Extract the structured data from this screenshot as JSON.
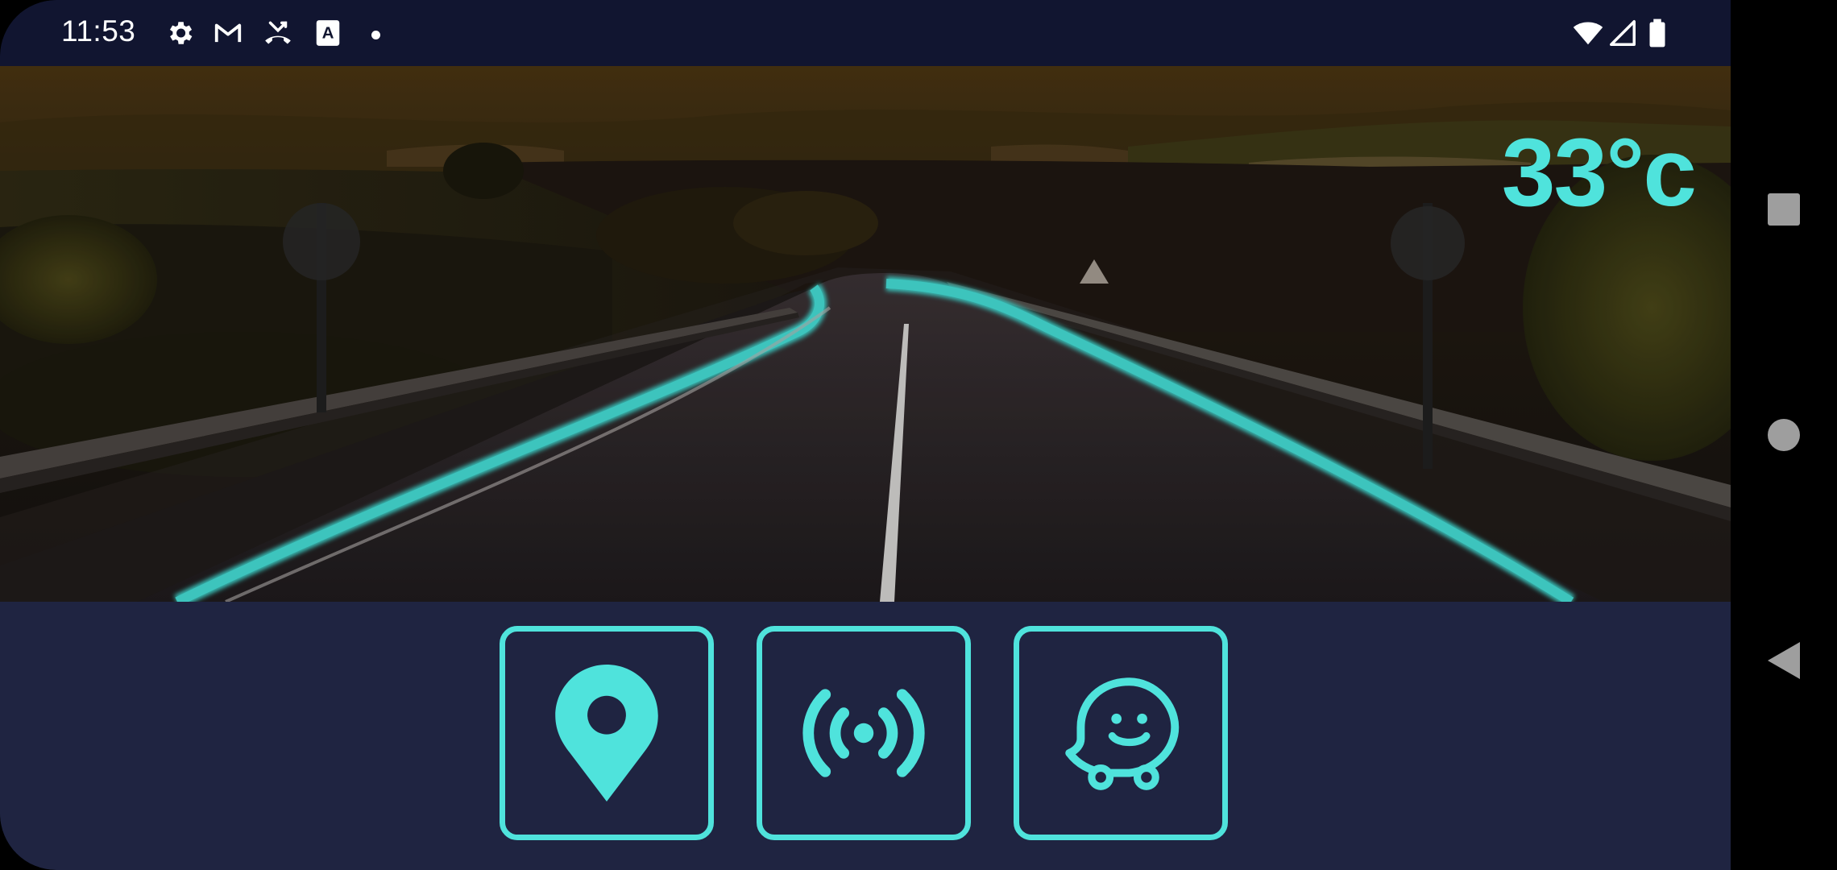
{
  "status_bar": {
    "time": "11:53",
    "left_icons": [
      "gear-icon",
      "gmail-icon",
      "missed-call-icon",
      "font-icon"
    ],
    "right_icons": [
      "wifi-icon",
      "cell-signal-icon",
      "battery-icon"
    ]
  },
  "scene": {
    "temperature": "33°c",
    "background": "dark-road-with-cyan-lane-lines"
  },
  "actions": [
    {
      "name": "location",
      "icon": "location-pin-icon"
    },
    {
      "name": "broadcast",
      "icon": "broadcast-signal-icon"
    },
    {
      "name": "waze",
      "icon": "waze-icon"
    }
  ],
  "navigation": {
    "buttons": [
      "recents-button",
      "home-button",
      "back-button"
    ]
  },
  "colors": {
    "accent": "#4fe3dc",
    "status_bar": "#111530",
    "panel": "#1f2441"
  }
}
